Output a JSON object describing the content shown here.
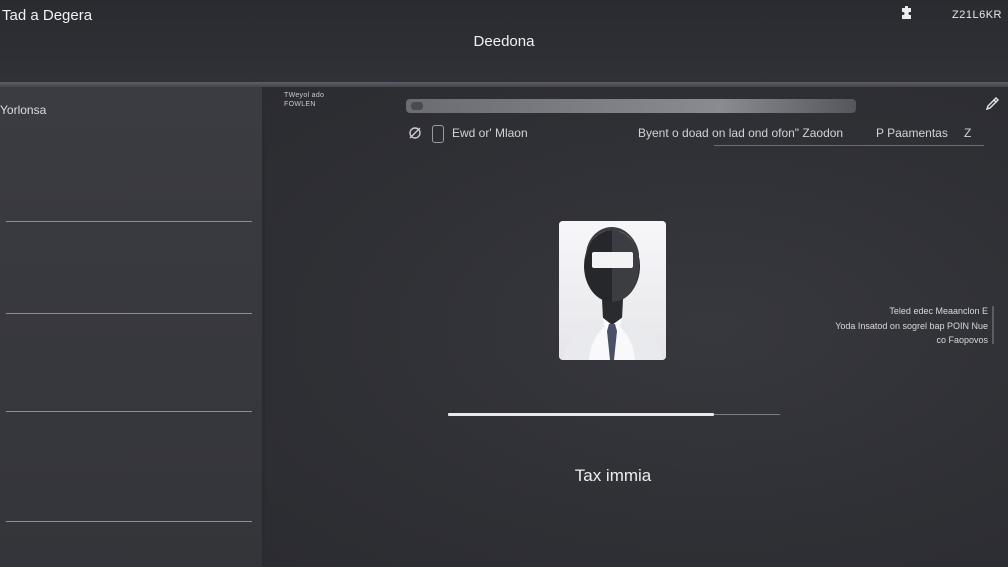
{
  "header": {
    "app_title": "Tad a Degera",
    "window_title": "Deedona",
    "code": "Z21L6KR",
    "menu_icon": "puzzle-icon"
  },
  "sidebar": {
    "title": "Yorlonsa"
  },
  "toolbar": {
    "label_line1": "TWeyol ado",
    "label_line2": "FOWLEN",
    "edit_icon": "pencil-icon",
    "search_icon": "search-icon"
  },
  "filters": {
    "left_text": "Ewd or' Mlaon",
    "right_text": "Byent o doad on lad ond ofon\" Zaodon",
    "param_label": "P Paamentas",
    "end_mark": "Z"
  },
  "profile": {
    "avatar_icon": "user-avatar-icon",
    "progress": 0.8,
    "caption": "Tax immia"
  },
  "note": {
    "line1": "Teled edec Meaanclon E",
    "line2": "Yoda Insatod on sogrel bap POIN Nue",
    "line3": "co Faopovos"
  },
  "colors": {
    "background": "#2f3036",
    "sidebar": "#3a3b41",
    "accent": "#e9e9ec",
    "tie": "#4a5066"
  }
}
